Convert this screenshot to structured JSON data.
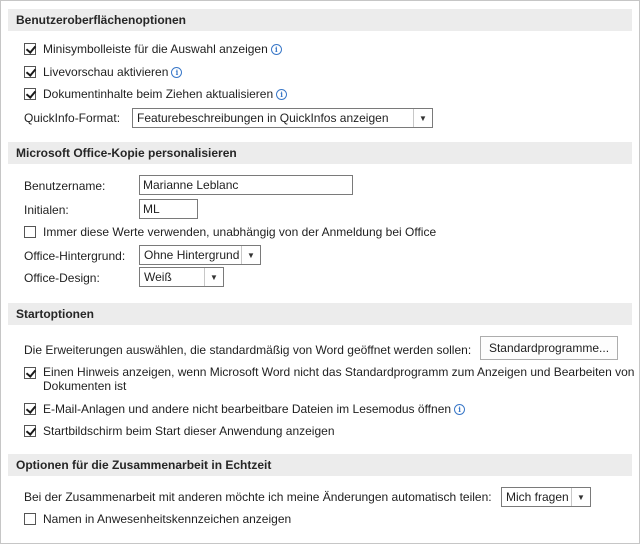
{
  "sections": {
    "ui": {
      "title": "Benutzeroberflächenoptionen",
      "minitoolbar": "Minisymbolleiste für die Auswahl anzeigen",
      "livepreview": "Livevorschau aktivieren",
      "dragcontent": "Dokumentinhalte beim Ziehen aktualisieren",
      "quickinfo_label": "QuickInfo-Format:",
      "quickinfo_value": "Featurebeschreibungen in QuickInfos anzeigen"
    },
    "personalize": {
      "title": "Microsoft Office-Kopie personalisieren",
      "username_label": "Benutzername:",
      "username_value": "Marianne Leblanc",
      "initials_label": "Initialen:",
      "initials_value": "ML",
      "always_use": "Immer diese Werte verwenden, unabhängig von der Anmeldung bei Office",
      "background_label": "Office-Hintergrund:",
      "background_value": "Ohne Hintergrund",
      "design_label": "Office-Design:",
      "design_value": "Weiß"
    },
    "start": {
      "title": "Startoptionen",
      "extensions_text": "Die Erweiterungen auswählen, die standardmäßig von Word geöffnet werden sollen:",
      "default_programs_button": "Standardprogramme...",
      "notify_line1": "Einen Hinweis anzeigen, wenn Microsoft Word nicht das Standardprogramm zum Anzeigen und Bearbeiten von",
      "notify_line2": "Dokumenten ist",
      "reading_mode": "E-Mail-Anlagen und andere nicht bearbeitbare Dateien im Lesemodus öffnen",
      "start_screen": "Startbildschirm beim Start dieser Anwendung anzeigen"
    },
    "collab": {
      "title": "Optionen für die Zusammenarbeit in Echtzeit",
      "share_text": "Bei der Zusammenarbeit mit anderen möchte ich meine Änderungen automatisch teilen:",
      "share_value": "Mich fragen",
      "presence_names": "Namen in Anwesenheitskennzeichen anzeigen"
    }
  },
  "icons": {
    "info": "info-icon",
    "dropdown": "chevron-down-icon"
  }
}
